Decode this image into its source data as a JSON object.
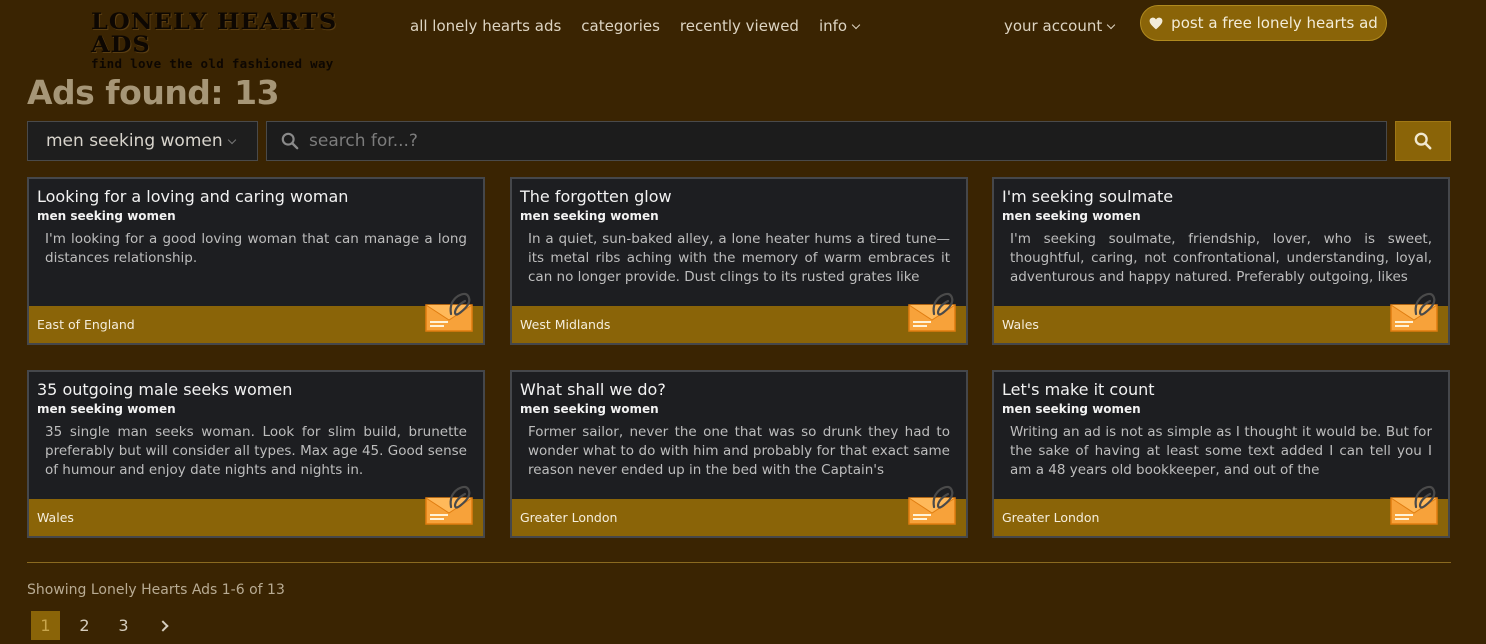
{
  "logo": {
    "line1": "LONELY HEARTS ADS",
    "line2": "find love the old fashioned way"
  },
  "nav": {
    "all": "all lonely hearts ads",
    "categories": "categories",
    "recent": "recently viewed",
    "info": "info"
  },
  "account": "your account",
  "post_button": "post a free lonely hearts ad",
  "heading": "Ads found: 13",
  "search": {
    "category": "men seeking women",
    "placeholder": "search for...?"
  },
  "ads": [
    {
      "title": "Looking for a loving and caring woman",
      "category": "men seeking women",
      "body": "I'm looking for a good loving woman that can manage a long distances relationship.",
      "location": "East of England"
    },
    {
      "title": "The forgotten glow",
      "category": "men seeking women",
      "body": "In a quiet, sun-baked alley, a lone heater hums a tired tune—its metal ribs aching with the memory of warm embraces it can no longer provide. Dust clings to its rusted grates like",
      "location": "West Midlands"
    },
    {
      "title": "I'm seeking soulmate",
      "category": "men seeking women",
      "body": "I'm seeking soulmate, friendship, lover, who is sweet, thoughtful, caring, not confrontational, understanding, loyal, adventurous and happy natured. Preferably outgoing, likes",
      "location": "Wales"
    },
    {
      "title": "35 outgoing male seeks women",
      "category": "men seeking women",
      "body": "35 single man seeks woman. Look for slim build, brunette preferably but will consider all types. Max age 45. Good sense of humour and enjoy date nights and nights in.",
      "location": "Wales"
    },
    {
      "title": "What shall we do?",
      "category": "men seeking women",
      "body": "Former sailor, never the one that was so drunk they had to wonder what to do with him and probably for that exact same reason never ended up in the bed with the Captain's",
      "location": "Greater London"
    },
    {
      "title": "Let's make it count",
      "category": "men seeking women",
      "body": "Writing an ad is not as simple as I thought it would be. But for the sake of having at least some text added I can tell you I am a 48 years old bookkeeper, and out of the",
      "location": "Greater London"
    }
  ],
  "showing": "Showing Lonely Hearts Ads 1-6 of 13",
  "pages": [
    "1",
    "2",
    "3"
  ],
  "colors": {
    "background": "#3a2402",
    "accent": "#8a6408",
    "card": "#1d1e21"
  }
}
